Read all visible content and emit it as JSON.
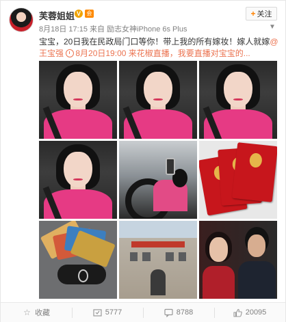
{
  "post": {
    "author": "芙蓉姐姐",
    "verified_badge": "V",
    "vip_badge": "会",
    "meta": {
      "date": "8月18日 17:15",
      "source_prefix": "来自",
      "source": "励志女神iPhone 6s Plus"
    },
    "follow_label": "关注",
    "follow_symbol": "+",
    "text": {
      "part1": "宝宝，20日我在民政局门口等你！带上我的所有嫁妆！嫁人就嫁",
      "mention": "@王宝强",
      "event": "8月20日19:00 来花椒直播，我要直播对宝宝的..."
    },
    "photos": [
      {
        "name": "selfie-car-1",
        "kind": "selfie"
      },
      {
        "name": "selfie-car-2",
        "kind": "selfie"
      },
      {
        "name": "selfie-car-3",
        "kind": "selfie"
      },
      {
        "name": "selfie-car-4",
        "kind": "selfie"
      },
      {
        "name": "car-driving",
        "kind": "car"
      },
      {
        "name": "marriage-certificates",
        "kind": "cert"
      },
      {
        "name": "bank-cards-car-key",
        "kind": "cards"
      },
      {
        "name": "civil-affairs-bureau",
        "kind": "bureau"
      },
      {
        "name": "couple-poster",
        "kind": "poster"
      }
    ]
  },
  "footer": {
    "favorite_label": "收藏",
    "favorite_icon": "star-icon",
    "repost_count": "5777",
    "repost_icon": "repost-icon",
    "comment_count": "8788",
    "comment_icon": "comment-icon",
    "like_count": "20095",
    "like_icon": "thumbs-up-icon"
  },
  "colors": {
    "link": "#eb7350",
    "accent": "#ff8200",
    "muted": "#808080"
  }
}
